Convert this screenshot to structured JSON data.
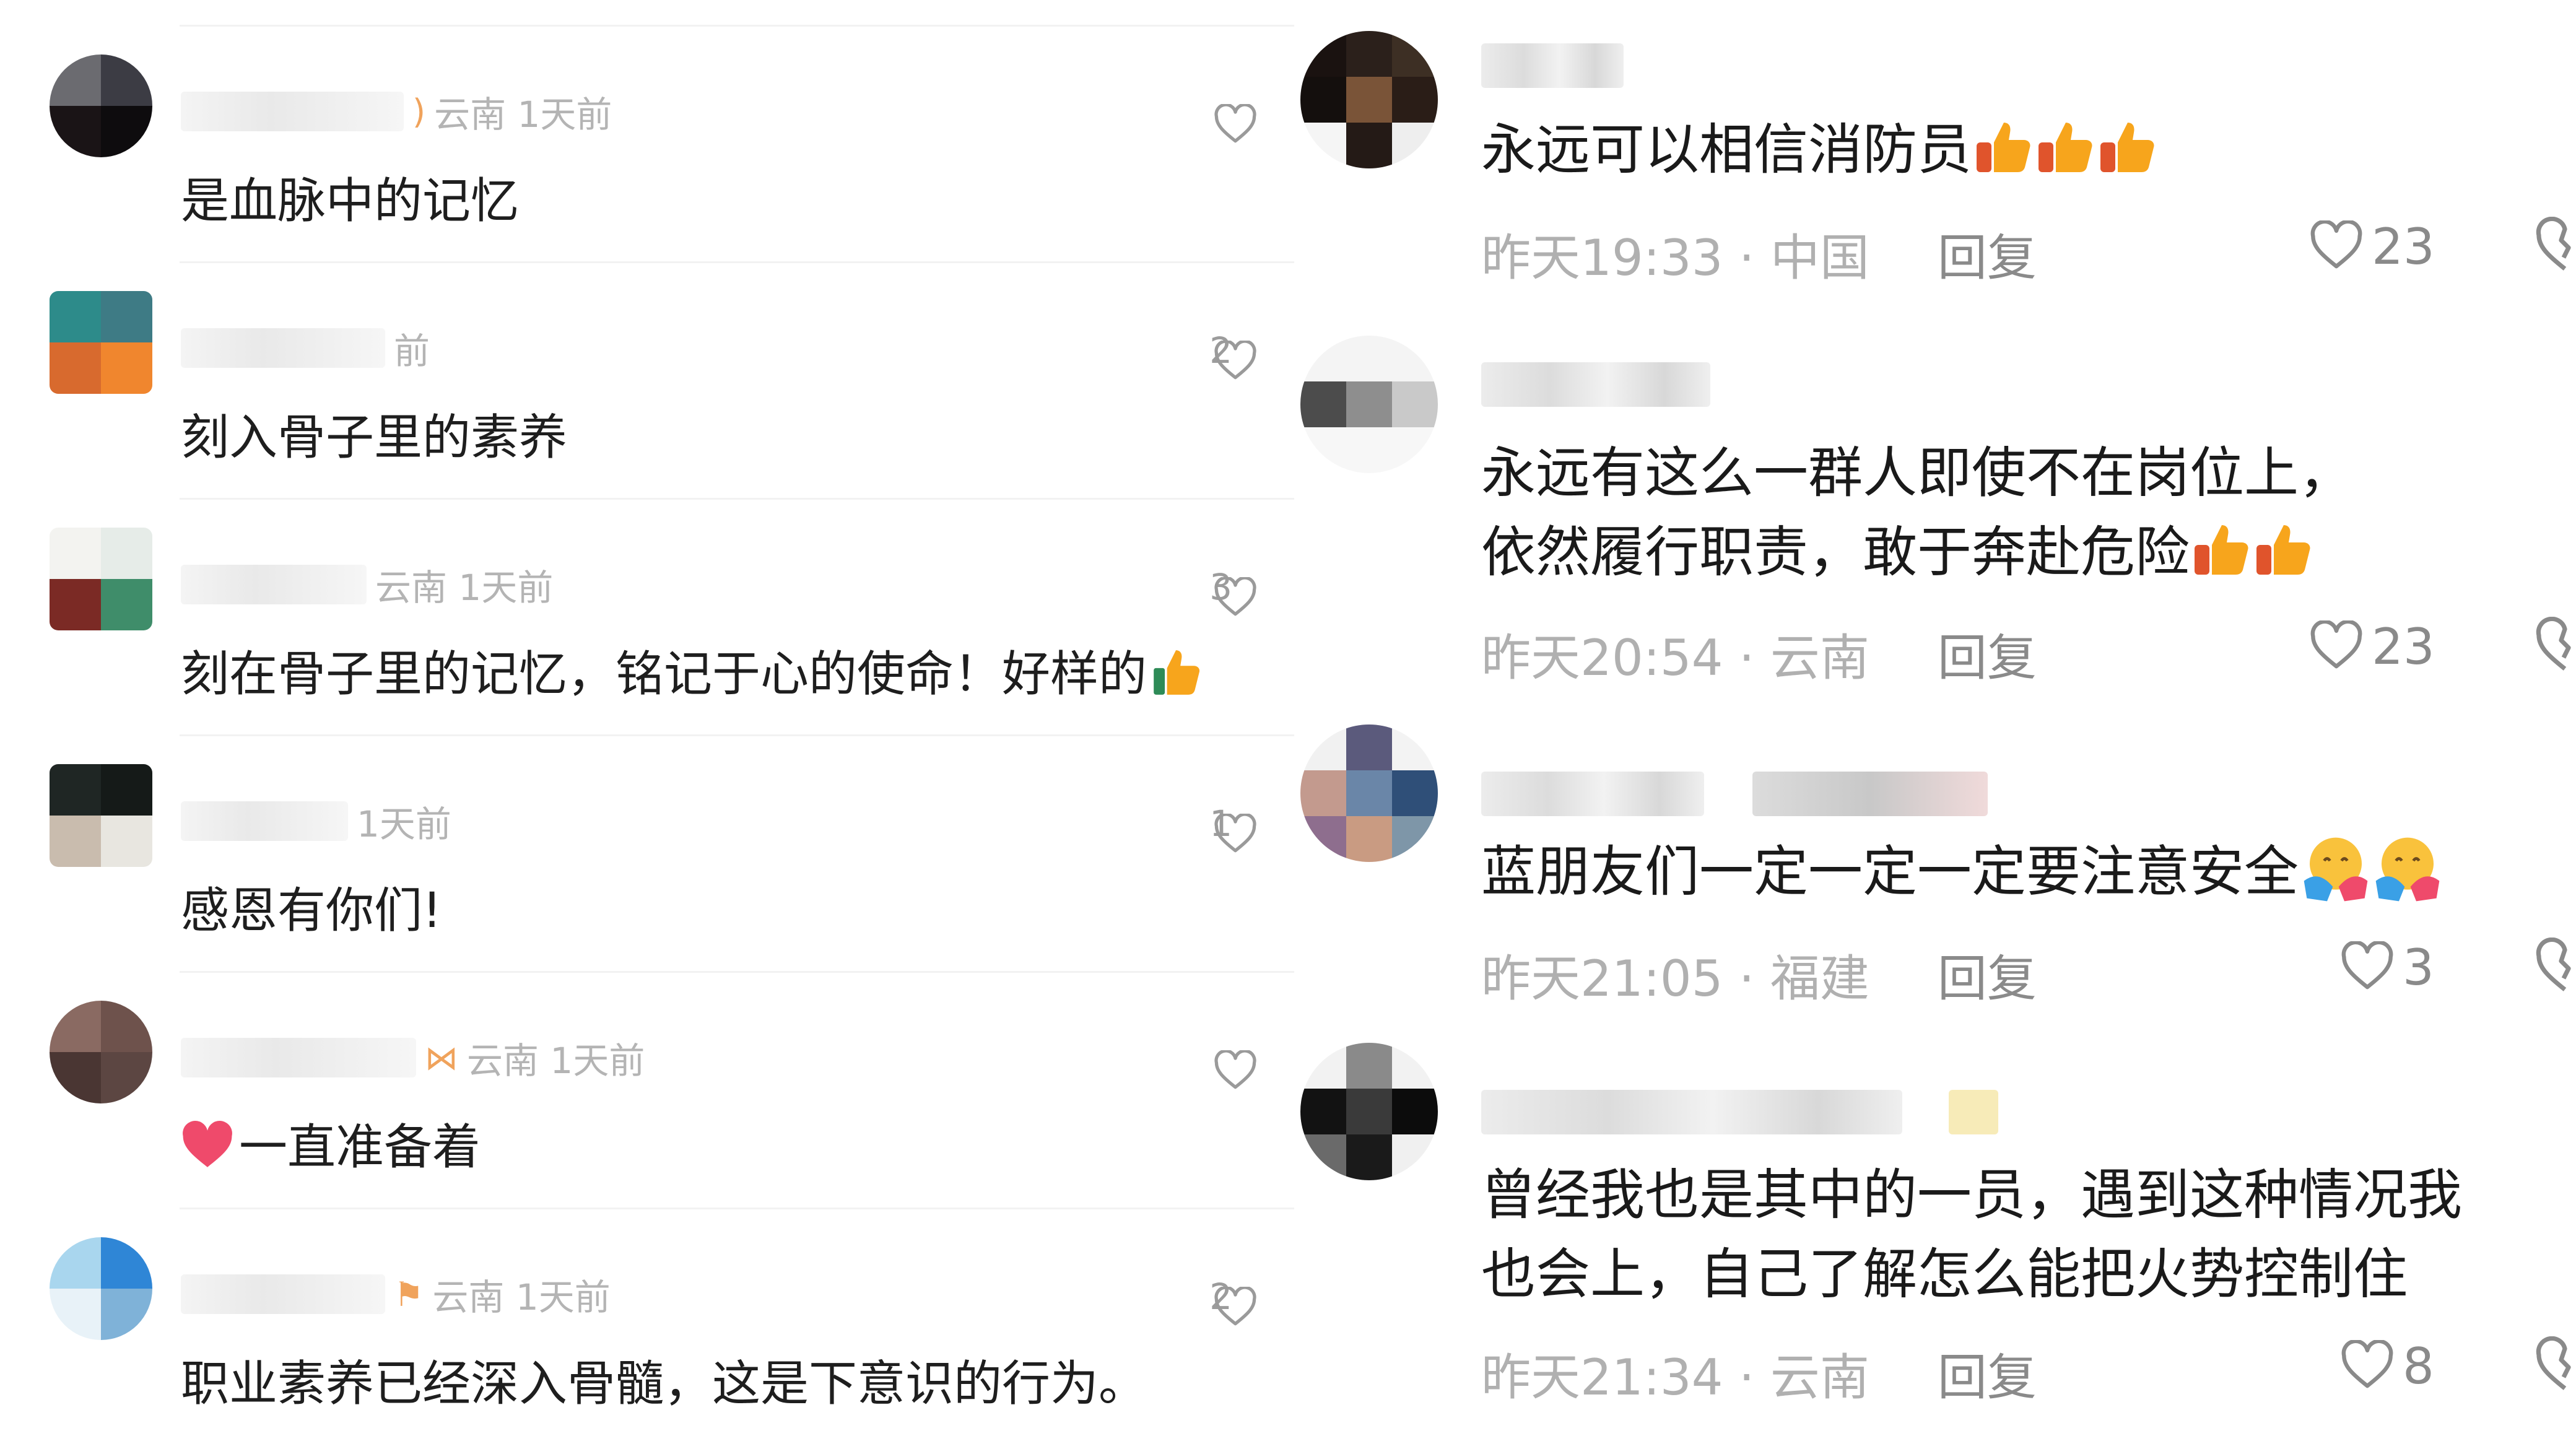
{
  "left_comments": [
    {
      "meta": "云南 1天前",
      "text": "是血脉中的记忆",
      "likes": "",
      "badge": "ear"
    },
    {
      "meta": "前",
      "text": "刻入骨子里的素养",
      "likes": "2",
      "badge": ""
    },
    {
      "meta": "云南 1天前",
      "text": "刻在骨子里的记忆，铭记于心的使命！好样的",
      "likes": "3",
      "badge": ""
    },
    {
      "meta": "1天前",
      "text": "感恩有你们!",
      "likes": "1",
      "badge": ""
    },
    {
      "meta": "云南 1天前",
      "text": "一直准备着",
      "likes": "",
      "badge": "bow"
    },
    {
      "meta": "云南 1天前",
      "text": "职业素养已经深入骨髓，这是下意识的行为。",
      "likes": "2",
      "badge": "flag"
    }
  ],
  "right_comments": [
    {
      "lines": [
        "永远可以相信消防员"
      ],
      "emoji": "thumbs-up",
      "emoji_count": 3,
      "time": "昨天19:33",
      "region": "中国",
      "reply": "回复",
      "likes": "23"
    },
    {
      "lines": [
        "永远有这么一群人即使不在岗位上，",
        "依然履行职责，敢于奔赴危险"
      ],
      "emoji": "thumbs-up",
      "emoji_count": 2,
      "time": "昨天20:54",
      "region": "云南",
      "reply": "回复",
      "likes": "23"
    },
    {
      "lines": [
        "蓝朋友们一定一定一定要注意安全"
      ],
      "emoji": "hugging-face",
      "emoji_count": 2,
      "time": "昨天21:05",
      "region": "福建",
      "reply": "回复",
      "likes": "3"
    },
    {
      "lines": [
        "曾经我也是其中的一员，遇到这种情况我",
        "也会上，自己了解怎么能把火势控制住"
      ],
      "emoji": "",
      "emoji_count": 0,
      "time": "昨天21:34",
      "region": "云南",
      "reply": "回复",
      "likes": "8"
    }
  ],
  "meta_separator": "·",
  "colors": {
    "heart_red": "#ef4a6b",
    "thumb_orange": "#f7a51c",
    "meta_grey": "#b0b0b0",
    "badge_orange": "#f0a35c"
  }
}
